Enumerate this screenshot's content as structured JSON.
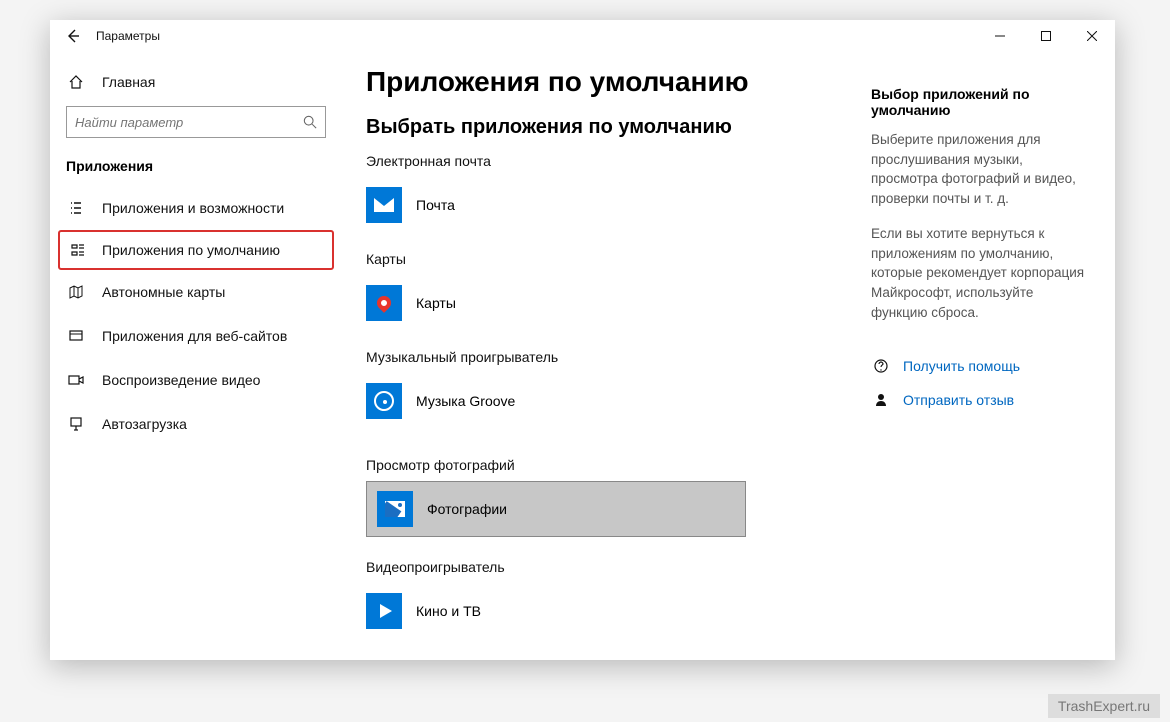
{
  "window": {
    "title": "Параметры"
  },
  "sidebar": {
    "home": "Главная",
    "search_placeholder": "Найти параметр",
    "section": "Приложения",
    "items": [
      {
        "label": "Приложения и возможности"
      },
      {
        "label": "Приложения по умолчанию"
      },
      {
        "label": "Автономные карты"
      },
      {
        "label": "Приложения для веб-сайтов"
      },
      {
        "label": "Воспроизведение видео"
      },
      {
        "label": "Автозагрузка"
      }
    ]
  },
  "main": {
    "page_title": "Приложения по умолчанию",
    "section_title": "Выбрать приложения по умолчанию",
    "defaults": [
      {
        "category": "Электронная почта",
        "app": "Почта"
      },
      {
        "category": "Карты",
        "app": "Карты"
      },
      {
        "category": "Музыкальный проигрыватель",
        "app": "Музыка Groove"
      },
      {
        "category": "Просмотр фотографий",
        "app": "Фотографии"
      },
      {
        "category": "Видеопроигрыватель",
        "app": "Кино и ТВ"
      }
    ]
  },
  "right": {
    "title": "Выбор приложений по умолчанию",
    "p1": "Выберите приложения для прослушивания музыки, просмотра фотографий и видео, проверки почты и т. д.",
    "p2": "Если вы хотите вернуться к приложениям по умолчанию, которые рекомендует корпорация Майкрософт, используйте функцию сброса.",
    "help": "Получить помощь",
    "feedback": "Отправить отзыв"
  },
  "watermark": "TrashExpert.ru"
}
